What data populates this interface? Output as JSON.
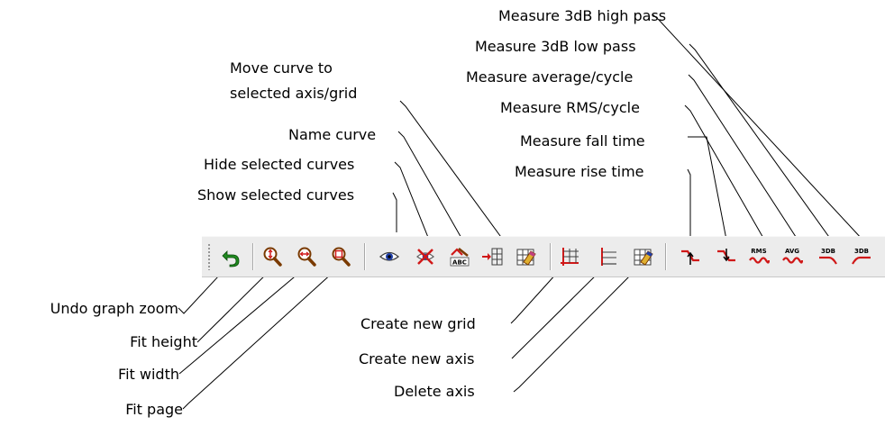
{
  "colors": {
    "toolbar_bg": "#ececec",
    "icon_red": "#d01818",
    "icon_green": "#1f8a1f",
    "icon_blue": "#1f3fa8"
  },
  "callouts": {
    "measure_3db_high_pass": "Measure 3dB high pass",
    "measure_3db_low_pass": "Measure 3dB low pass",
    "measure_average_cycle": "Measure average/cycle",
    "measure_rms_cycle": "Measure RMS/cycle",
    "measure_fall_time": "Measure fall time",
    "measure_rise_time": "Measure rise time",
    "move_curve_line1": "Move curve to",
    "move_curve_line2": "selected axis/grid",
    "name_curve": "Name curve",
    "hide_selected_curves": "Hide selected curves",
    "show_selected_curves": "Show selected curves",
    "undo_graph_zoom": "Undo graph zoom",
    "fit_height": "Fit height",
    "fit_width": "Fit width",
    "fit_page": "Fit page",
    "create_new_grid": "Create new grid",
    "create_new_axis": "Create new axis",
    "delete_axis": "Delete axis"
  },
  "toolbar": {
    "buttons": [
      {
        "id": "undo-graph-zoom",
        "icon": "undo-arrow-icon"
      },
      {
        "id": "fit-height",
        "icon": "magnifier-vertical-icon"
      },
      {
        "id": "fit-width",
        "icon": "magnifier-horizontal-icon"
      },
      {
        "id": "fit-page",
        "icon": "magnifier-box-icon"
      },
      {
        "id": "show-selected-curves",
        "icon": "eye-icon"
      },
      {
        "id": "hide-selected-curves",
        "icon": "eye-crossed-icon"
      },
      {
        "id": "name-curve",
        "icon": "abc-label-icon"
      },
      {
        "id": "move-curve",
        "icon": "arrow-to-grid-icon"
      },
      {
        "id": "delete-curve-grid",
        "icon": "grid-eraser-icon"
      },
      {
        "id": "create-new-grid",
        "icon": "grid-icon"
      },
      {
        "id": "create-new-axis",
        "icon": "axis-icon"
      },
      {
        "id": "delete-axis",
        "icon": "axis-eraser-icon"
      },
      {
        "id": "measure-rise-time",
        "icon": "rise-edge-icon"
      },
      {
        "id": "measure-fall-time",
        "icon": "fall-edge-icon"
      },
      {
        "id": "measure-rms-cycle",
        "icon": "rms-wave-icon",
        "label": "RMS"
      },
      {
        "id": "measure-average-cycle",
        "icon": "avg-wave-icon",
        "label": "AVG"
      },
      {
        "id": "measure-3db-low-pass",
        "icon": "lowpass-icon",
        "label": "3DB"
      },
      {
        "id": "measure-3db-high-pass",
        "icon": "highpass-icon",
        "label": "3DB"
      }
    ]
  }
}
